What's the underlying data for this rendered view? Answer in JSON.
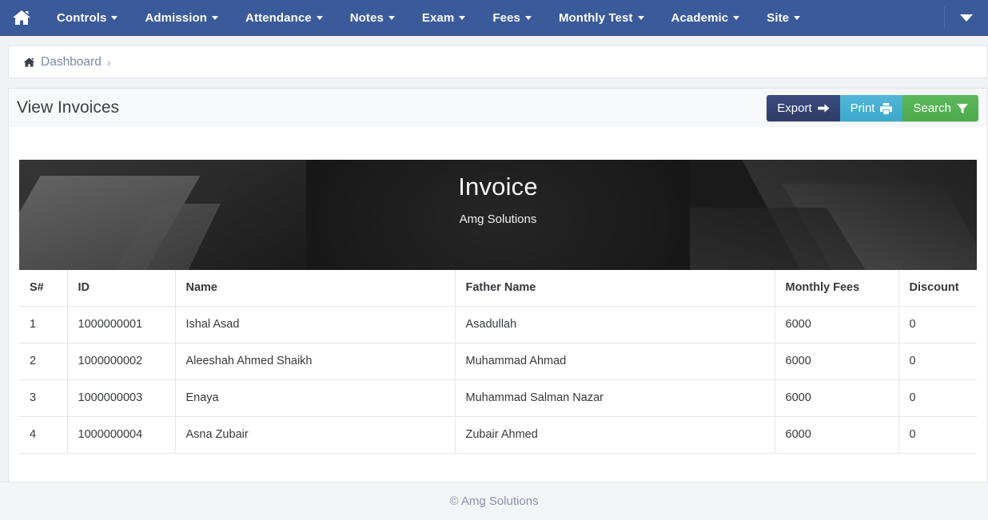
{
  "navbar": {
    "home_icon": "home-icon",
    "items": [
      {
        "label": "Controls",
        "has_caret": true
      },
      {
        "label": "Admission",
        "has_caret": true
      },
      {
        "label": "Attendance",
        "has_caret": true
      },
      {
        "label": "Notes",
        "has_caret": true
      },
      {
        "label": "Exam",
        "has_caret": true
      },
      {
        "label": "Fees",
        "has_caret": true
      },
      {
        "label": "Monthly Test",
        "has_caret": true
      },
      {
        "label": "Academic",
        "has_caret": true
      },
      {
        "label": "Site",
        "has_caret": true
      }
    ],
    "right_toggle_icon": "chevron-down-icon",
    "background_color": "#3b5a9a"
  },
  "breadcrumb": {
    "home_icon": "home-icon",
    "link_label": "Dashboard",
    "separator": "›"
  },
  "page_header": {
    "title": "View Invoices",
    "buttons": [
      {
        "label": "Export",
        "icon": "arrow-right-icon",
        "color": "#36467a"
      },
      {
        "label": "Print",
        "icon": "printer-icon",
        "color": "#46aecd"
      },
      {
        "label": "Search",
        "icon": "filter-icon",
        "color": "#55b155"
      }
    ]
  },
  "invoice": {
    "banner_title": "Invoice",
    "banner_subtitle": "Amg Solutions",
    "columns": [
      "S#",
      "ID",
      "Name",
      "Father Name",
      "Monthly Fees",
      "Discount"
    ],
    "rows": [
      {
        "sn": "1",
        "id": "1000000001",
        "name": "Ishal Asad",
        "father_name": "Asadullah",
        "monthly_fees": "6000",
        "discount": "0"
      },
      {
        "sn": "2",
        "id": "1000000002",
        "name": "Aleeshah Ahmed Shaikh",
        "father_name": "Muhammad Ahmad",
        "monthly_fees": "6000",
        "discount": "0"
      },
      {
        "sn": "3",
        "id": "1000000003",
        "name": "Enaya",
        "father_name": "Muhammad Salman Nazar",
        "monthly_fees": "6000",
        "discount": "0"
      },
      {
        "sn": "4",
        "id": "1000000004",
        "name": "Asna Zubair",
        "father_name": "Zubair Ahmed",
        "monthly_fees": "6000",
        "discount": "0"
      }
    ]
  },
  "footer": {
    "text": "© Amg Solutions"
  }
}
